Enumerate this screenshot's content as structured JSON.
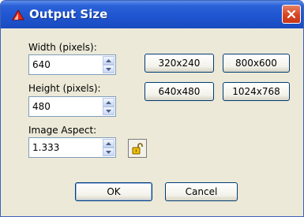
{
  "window": {
    "title": "Output Size"
  },
  "fields": {
    "width": {
      "label": "Width (pixels):",
      "value": "640"
    },
    "height": {
      "label": "Height (pixels):",
      "value": "480"
    },
    "aspect": {
      "label": "Image Aspect:",
      "value": "1.333"
    }
  },
  "presets": [
    "320x240",
    "800x600",
    "640x480",
    "1024x768"
  ],
  "buttons": {
    "ok": "OK",
    "cancel": "Cancel"
  },
  "colors": {
    "titlebar": "#1f55d0",
    "close": "#d8451f",
    "dialog_bg": "#ece9d8",
    "field_border": "#7f9db9"
  },
  "icons": {
    "app": "red-app-icon",
    "close": "close-icon",
    "lock": "lock-icon"
  }
}
